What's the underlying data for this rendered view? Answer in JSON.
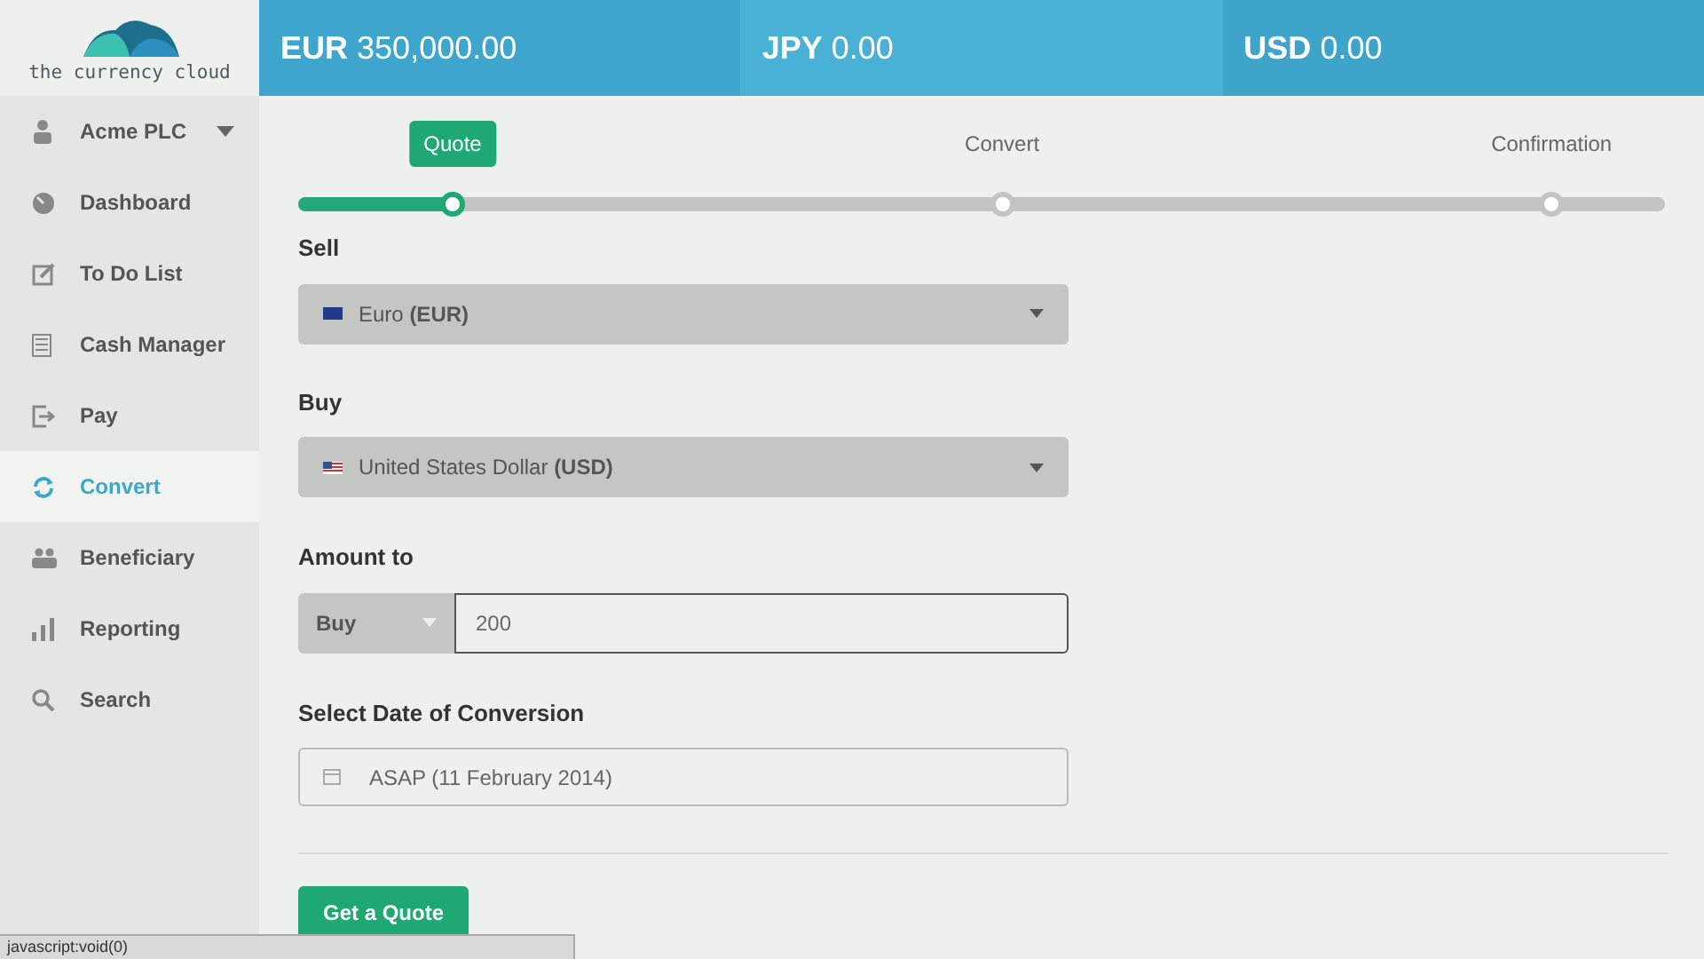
{
  "logo": {
    "text": "the currency cloud"
  },
  "balances": [
    {
      "currency": "EUR",
      "amount": "350,000.00"
    },
    {
      "currency": "JPY",
      "amount": "0.00"
    },
    {
      "currency": "USD",
      "amount": "0.00"
    }
  ],
  "account": {
    "name": "Acme PLC"
  },
  "sidebar": {
    "items": [
      {
        "label": "Dashboard",
        "kind": "dashboard",
        "selected": false
      },
      {
        "label": "To Do List",
        "kind": "todo",
        "selected": false
      },
      {
        "label": "Cash Manager",
        "kind": "cash",
        "selected": false
      },
      {
        "label": "Pay",
        "kind": "pay",
        "selected": false
      },
      {
        "label": "Convert",
        "kind": "convert",
        "selected": true
      },
      {
        "label": "Beneficiary",
        "kind": "beneficiary",
        "selected": false
      },
      {
        "label": "Reporting",
        "kind": "reporting",
        "selected": false
      },
      {
        "label": "Search",
        "kind": "search",
        "selected": false
      }
    ]
  },
  "stepper": {
    "level": 0.113,
    "steps": [
      {
        "label": "Quote",
        "selected": true
      },
      {
        "label": "Convert",
        "selected": false
      },
      {
        "label": "Confirmation",
        "selected": false
      }
    ]
  },
  "form": {
    "sell": {
      "label": "Sell",
      "kind": "eu",
      "value": "Euro **(EUR)**"
    },
    "buy": {
      "label": "Buy",
      "kind": "us",
      "value": "United States Dollar **(USD)**"
    },
    "amount": {
      "label": "Amount to",
      "direction": "Buy",
      "value": "200"
    },
    "date": {
      "label": "Select Date of Conversion",
      "value": "ASAP (11 February 2014)"
    },
    "submit": "Get a Quote"
  },
  "status_bar": "javascript:void(0)"
}
